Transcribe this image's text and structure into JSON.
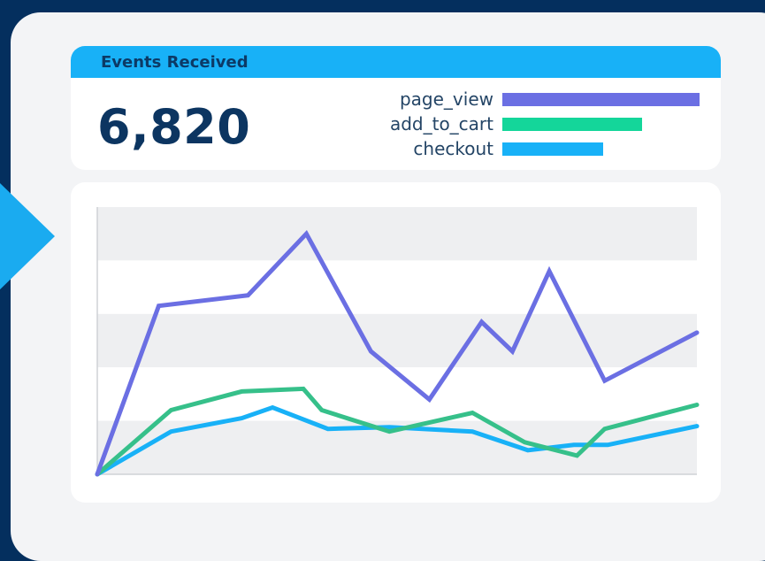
{
  "card": {
    "title": "Events Received",
    "total": "6,820"
  },
  "legend": [
    {
      "label": "page_view",
      "value": 1.0,
      "color": "#6b6fe3"
    },
    {
      "label": "add_to_cart",
      "value": 0.71,
      "color": "#14d69a"
    },
    {
      "label": "checkout",
      "value": 0.51,
      "color": "#18b1f7"
    }
  ],
  "chart_data": {
    "type": "line",
    "grid": "alternating horizontal bands",
    "ylim": [
      0,
      5
    ],
    "series": [
      {
        "name": "page_view",
        "color": "#6b6fe3",
        "x": [
          0,
          1,
          2.45,
          3.4,
          4.45,
          5.4,
          6.25,
          6.75,
          7.35,
          8.25,
          9.75
        ],
        "y": [
          0,
          3.15,
          3.35,
          4.5,
          2.3,
          1.4,
          2.85,
          2.3,
          3.8,
          1.75,
          2.65
        ]
      },
      {
        "name": "add_to_cart",
        "color": "#36c08a",
        "x": [
          0,
          1.2,
          2.35,
          3.35,
          3.65,
          4.75,
          6.1,
          6.95,
          7.8,
          8.25,
          9.75
        ],
        "y": [
          0,
          1.2,
          1.55,
          1.6,
          1.2,
          0.8,
          1.15,
          0.6,
          0.35,
          0.85,
          1.3
        ]
      },
      {
        "name": "checkout",
        "color": "#18b1f7",
        "x": [
          0,
          1.2,
          2.35,
          2.85,
          3.75,
          4.75,
          6.1,
          7,
          7.75,
          8.3,
          9.75
        ],
        "y": [
          0,
          0.8,
          1.05,
          1.25,
          0.85,
          0.88,
          0.8,
          0.45,
          0.55,
          0.55,
          0.9
        ]
      }
    ]
  }
}
